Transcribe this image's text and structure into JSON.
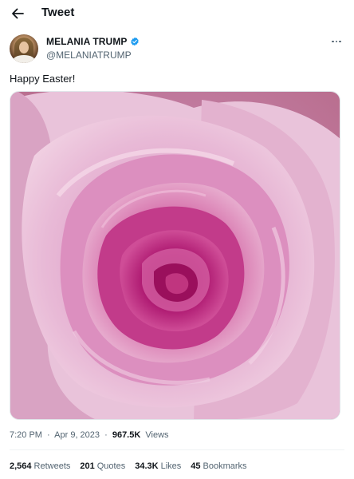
{
  "header": {
    "title": "Tweet",
    "back_icon": "arrow-left-icon"
  },
  "author": {
    "name": "MELANIA TRUMP",
    "handle": "@MELANIATRUMP",
    "verified_icon": "verified-badge-icon",
    "verified_color": "#1d9bf0",
    "more_icon": "more-horizontal-icon"
  },
  "tweet": {
    "text": "Happy Easter!",
    "media_description_icon": "pink-rose-photo"
  },
  "meta": {
    "time": "7:20 PM",
    "separator": "·",
    "date": "Apr 9, 2023",
    "separator2": "·",
    "views_count": "967.5K",
    "views_label": "Views"
  },
  "stats": {
    "retweets_count": "2,564",
    "retweets_label": "Retweets",
    "quotes_count": "201",
    "quotes_label": "Quotes",
    "likes_count": "34.3K",
    "likes_label": "Likes",
    "bookmarks_count": "45",
    "bookmarks_label": "Bookmarks"
  },
  "colors": {
    "text_primary": "#0f1419",
    "text_secondary": "#536471",
    "rose_dark": "#a8106a",
    "rose_light": "#ecc4dc"
  }
}
